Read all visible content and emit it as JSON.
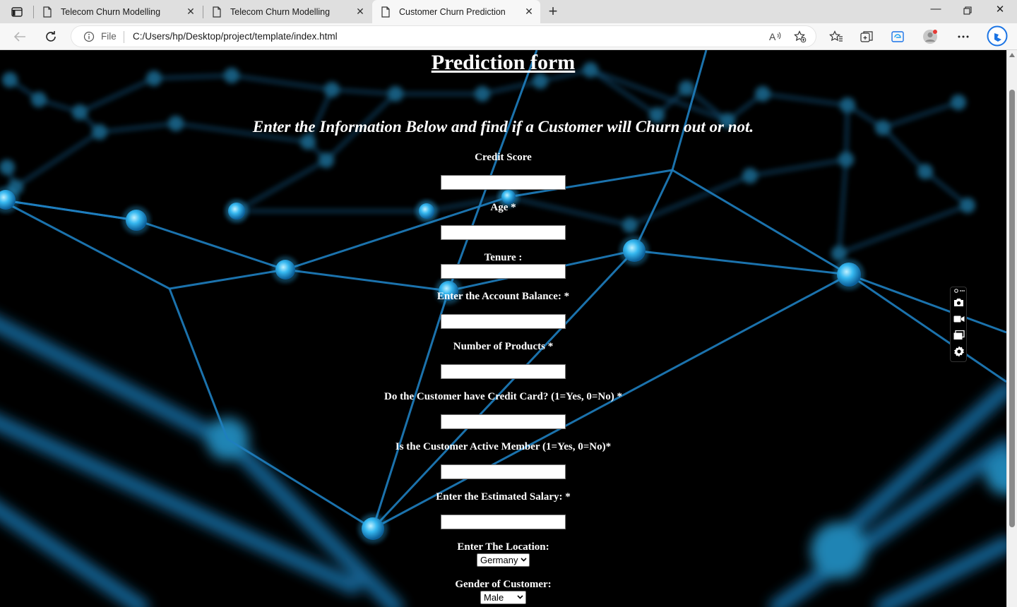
{
  "browser": {
    "tabs": [
      {
        "title": "Telecom Churn Modelling",
        "active": false
      },
      {
        "title": "Telecom Churn Modelling",
        "active": false
      },
      {
        "title": "Customer Churn Prediction",
        "active": true
      }
    ],
    "address": {
      "scheme_label": "File",
      "url": "C:/Users/hp/Desktop/project/template/index.html"
    },
    "icons": [
      "tab-actions-icon",
      "page-icon",
      "close-icon",
      "plus-icon",
      "minimize-icon",
      "restore-icon",
      "window-close-icon",
      "back-icon",
      "refresh-icon",
      "info-icon",
      "read-aloud-icon",
      "add-favorite-icon",
      "favorites-icon",
      "collections-icon",
      "edge-icon",
      "profile-icon",
      "more-icon",
      "bing-icon"
    ]
  },
  "page": {
    "title": "Prediction form",
    "subtitle": "Enter the Information Below and find if a Customer will Churn out or not.",
    "fields": [
      {
        "label": "Credit Score",
        "value": ""
      },
      {
        "label": "Age *",
        "value": ""
      },
      {
        "label": "Tenure :",
        "value": ""
      },
      {
        "label": "Enter the Account Balance: *",
        "value": ""
      },
      {
        "label": "Number of Products *",
        "value": ""
      },
      {
        "label": "Do the Customer have Credit Card? (1=Yes, 0=No) *",
        "value": ""
      },
      {
        "label": "Is the Customer Active Member (1=Yes, 0=No)*",
        "value": ""
      },
      {
        "label": "Enter the Estimated Salary: *",
        "value": ""
      }
    ],
    "location": {
      "label": "Enter The Location:",
      "selected": "Germany"
    },
    "gender": {
      "label": "Gender of Customer:",
      "selected": "Male"
    }
  },
  "side_toolbar": {
    "icons": [
      "camera-icon",
      "video-icon",
      "screens-icon",
      "settings-icon"
    ]
  },
  "colors": {
    "node": "#2aa8e6",
    "line": "#1f7fbf",
    "page_bg": "#000000"
  }
}
